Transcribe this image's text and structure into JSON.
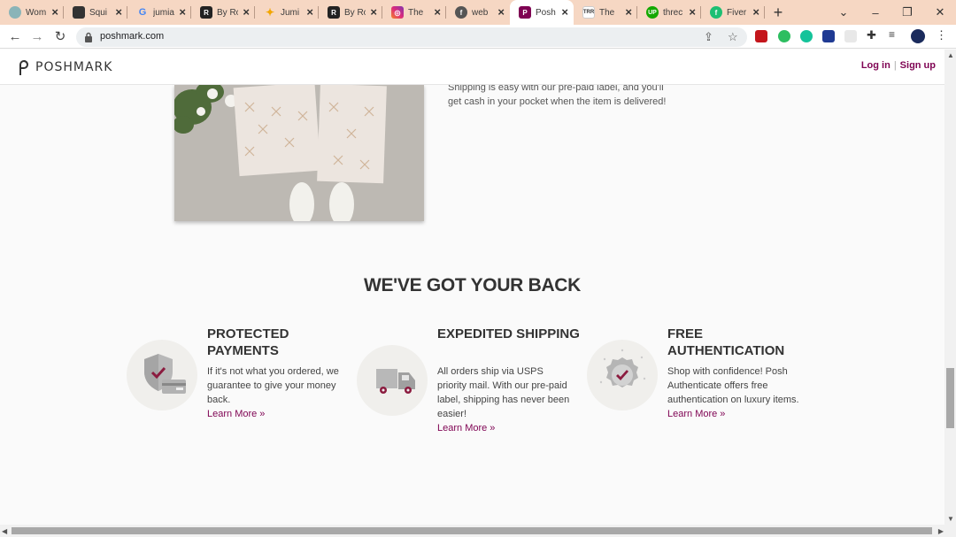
{
  "browser": {
    "tabs": [
      {
        "title": "Wom",
        "icon": "globe-icon",
        "color": "#8ab4b8"
      },
      {
        "title": "Squi",
        "icon": "cube-icon",
        "color": "#333333"
      },
      {
        "title": "jumia",
        "icon": "google-icon",
        "color": "#4285f4"
      },
      {
        "title": "By Ro",
        "icon": "r-logo-icon",
        "color": "#222222"
      },
      {
        "title": "Jumi",
        "icon": "star-icon",
        "color": "#f2a600"
      },
      {
        "title": "By Ro",
        "icon": "r-logo-icon",
        "color": "#222222"
      },
      {
        "title": "The",
        "icon": "instagram-icon",
        "color": "#d6249f"
      },
      {
        "title": "web",
        "icon": "facebook-icon",
        "color": "#555555"
      },
      {
        "title": "Posh",
        "icon": "poshmark-icon",
        "color": "#7f0353",
        "active": true
      },
      {
        "title": "The",
        "icon": "trr-icon",
        "color": "#ffffff"
      },
      {
        "title": "threc",
        "icon": "upwork-icon",
        "color": "#14a800"
      },
      {
        "title": "Fiver",
        "icon": "fiverr-icon",
        "color": "#1dbf73"
      }
    ],
    "new_tab": "+",
    "url": "poshmark.com"
  },
  "site": {
    "logo_text": "POSHMARK",
    "login": "Log in",
    "signup": "Sign up",
    "brand_color": "#7f0353"
  },
  "shipping": {
    "text": "Shipping is easy with our pre-paid label, and you'll get cash in your pocket when the item is delivered!"
  },
  "back": {
    "title": "WE'VE GOT YOUR BACK",
    "features": [
      {
        "title": "PROTECTED PAYMENTS",
        "body": "If it's not what you ordered, we guarantee to give your money back.",
        "link": "Learn More  »",
        "icon": "shield-card-icon"
      },
      {
        "title": "EXPEDITED SHIPPING",
        "body": "All orders ship via USPS priority mail. With our pre-paid label, shipping has never been easier!",
        "link": "Learn More  »",
        "icon": "truck-icon"
      },
      {
        "title": "FREE AUTHENTICATION",
        "body": "Shop with confidence! Posh Authenticate offers free authentication on luxury items.",
        "link": "Learn More  »",
        "icon": "authentic-badge-icon"
      }
    ]
  }
}
